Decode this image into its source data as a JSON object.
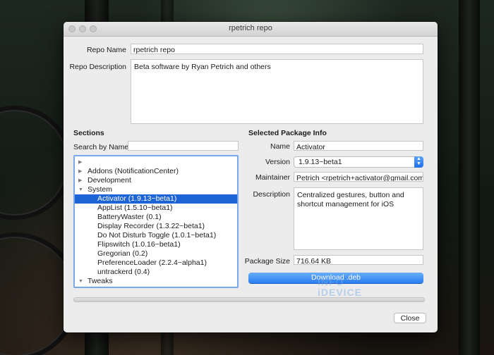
{
  "window": {
    "title": "rpetrich repo"
  },
  "repo": {
    "name_label": "Repo Name",
    "name_value": "rpetrich repo",
    "description_label": "Repo Description",
    "description_value": "Beta software by Ryan Petrich and others"
  },
  "sections": {
    "heading": "Sections",
    "search_label": "Search by Name",
    "search_value": "",
    "tree": [
      {
        "label": "",
        "level": 0,
        "disclosure": "collapsed"
      },
      {
        "label": "Addons (NotificationCenter)",
        "level": 0,
        "disclosure": "collapsed"
      },
      {
        "label": "Development",
        "level": 0,
        "disclosure": "collapsed"
      },
      {
        "label": "System",
        "level": 0,
        "disclosure": "expanded"
      },
      {
        "label": "Activator (1.9.13~beta1)",
        "level": 1,
        "selected": true
      },
      {
        "label": "AppList (1.5.10~beta1)",
        "level": 1
      },
      {
        "label": "BatteryWaster (0.1)",
        "level": 1
      },
      {
        "label": "Display Recorder (1.3.22~beta1)",
        "level": 1
      },
      {
        "label": "Do Not Disturb Toggle (1.0.1~beta1)",
        "level": 1
      },
      {
        "label": "Flipswitch (1.0.16~beta1)",
        "level": 1
      },
      {
        "label": "Gregorian (0.2)",
        "level": 1
      },
      {
        "label": "PreferenceLoader (2.2.4~alpha1)",
        "level": 1
      },
      {
        "label": "untrackerd (0.4)",
        "level": 1
      },
      {
        "label": "Tweaks",
        "level": 0,
        "disclosure": "expanded"
      }
    ]
  },
  "package": {
    "heading": "Selected Package Info",
    "name_label": "Name",
    "name_value": "Activator",
    "version_label": "Version",
    "version_value": "1.9.13~beta1",
    "maintainer_label": "Maintainer",
    "maintainer_value": "Petrich <rpetrich+activator@gmail.com>",
    "description_label": "Description",
    "description_value": "Centralized gestures, button and shortcut management for iOS",
    "size_label": "Package Size",
    "size_value": "716.64 KB",
    "download_label": "Download .deb"
  },
  "footer": {
    "close_label": "Close"
  },
  "watermark": {
    "line1": "INFO",
    "line2": "iDEVICE"
  },
  "colors": {
    "selection": "#1d64d6",
    "accent": "#2a7df0"
  }
}
